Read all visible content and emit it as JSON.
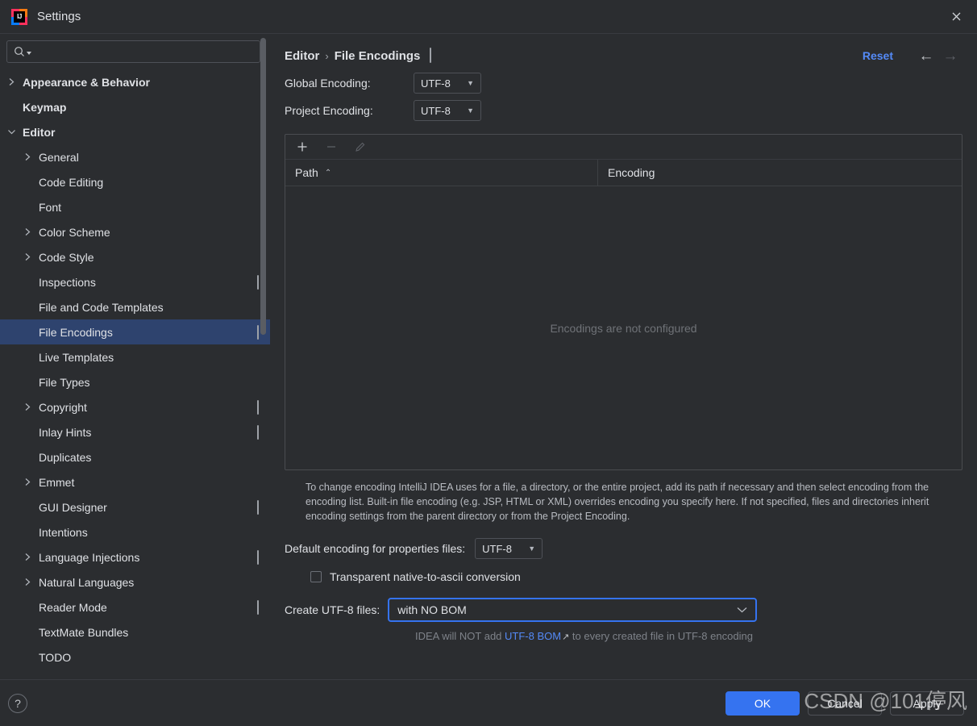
{
  "window": {
    "title": "Settings",
    "logo_icon": "intellij-idea-logo",
    "close_icon": "close-icon"
  },
  "search": {
    "value": "",
    "placeholder": "",
    "icon": "search-icon"
  },
  "sidebar": {
    "items": [
      {
        "label": "Appearance & Behavior",
        "level": 0,
        "arrow": "chevron-right",
        "bold": true,
        "badge": false,
        "selected": false
      },
      {
        "label": "Keymap",
        "level": 0,
        "arrow": "none",
        "bold": true,
        "badge": false,
        "selected": false
      },
      {
        "label": "Editor",
        "level": 0,
        "arrow": "chevron-down",
        "bold": true,
        "badge": false,
        "selected": false
      },
      {
        "label": "General",
        "level": 1,
        "arrow": "chevron-right",
        "bold": false,
        "badge": false,
        "selected": false
      },
      {
        "label": "Code Editing",
        "level": 1,
        "arrow": "none",
        "bold": false,
        "badge": false,
        "selected": false
      },
      {
        "label": "Font",
        "level": 1,
        "arrow": "none",
        "bold": false,
        "badge": false,
        "selected": false
      },
      {
        "label": "Color Scheme",
        "level": 1,
        "arrow": "chevron-right",
        "bold": false,
        "badge": false,
        "selected": false
      },
      {
        "label": "Code Style",
        "level": 1,
        "arrow": "chevron-right",
        "bold": false,
        "badge": false,
        "selected": false
      },
      {
        "label": "Inspections",
        "level": 1,
        "arrow": "none",
        "bold": false,
        "badge": true,
        "selected": false
      },
      {
        "label": "File and Code Templates",
        "level": 1,
        "arrow": "none",
        "bold": false,
        "badge": false,
        "selected": false
      },
      {
        "label": "File Encodings",
        "level": 1,
        "arrow": "none",
        "bold": false,
        "badge": true,
        "selected": true
      },
      {
        "label": "Live Templates",
        "level": 1,
        "arrow": "none",
        "bold": false,
        "badge": false,
        "selected": false
      },
      {
        "label": "File Types",
        "level": 1,
        "arrow": "none",
        "bold": false,
        "badge": false,
        "selected": false
      },
      {
        "label": "Copyright",
        "level": 1,
        "arrow": "chevron-right",
        "bold": false,
        "badge": true,
        "selected": false
      },
      {
        "label": "Inlay Hints",
        "level": 1,
        "arrow": "none",
        "bold": false,
        "badge": true,
        "selected": false
      },
      {
        "label": "Duplicates",
        "level": 1,
        "arrow": "none",
        "bold": false,
        "badge": false,
        "selected": false
      },
      {
        "label": "Emmet",
        "level": 1,
        "arrow": "chevron-right",
        "bold": false,
        "badge": false,
        "selected": false
      },
      {
        "label": "GUI Designer",
        "level": 1,
        "arrow": "none",
        "bold": false,
        "badge": true,
        "selected": false
      },
      {
        "label": "Intentions",
        "level": 1,
        "arrow": "none",
        "bold": false,
        "badge": false,
        "selected": false
      },
      {
        "label": "Language Injections",
        "level": 1,
        "arrow": "chevron-right",
        "bold": false,
        "badge": true,
        "selected": false
      },
      {
        "label": "Natural Languages",
        "level": 1,
        "arrow": "chevron-right",
        "bold": false,
        "badge": false,
        "selected": false
      },
      {
        "label": "Reader Mode",
        "level": 1,
        "arrow": "none",
        "bold": false,
        "badge": true,
        "selected": false
      },
      {
        "label": "TextMate Bundles",
        "level": 1,
        "arrow": "none",
        "bold": false,
        "badge": false,
        "selected": false
      },
      {
        "label": "TODO",
        "level": 1,
        "arrow": "none",
        "bold": false,
        "badge": false,
        "selected": false
      }
    ]
  },
  "header": {
    "breadcrumb_parent": "Editor",
    "breadcrumb_separator": "›",
    "breadcrumb_current": "File Encodings",
    "badge_icon": "project-level-badge-icon",
    "reset_label": "Reset",
    "back_icon": "←",
    "forward_icon": "→"
  },
  "encodings": {
    "global_label": "Global Encoding:",
    "global_value": "UTF-8",
    "project_label": "Project Encoding:",
    "project_value": "UTF-8",
    "toolbar": {
      "add_icon": "plus-icon",
      "remove_icon": "minus-icon",
      "edit_icon": "pencil-icon"
    },
    "columns": [
      "Path",
      "Encoding"
    ],
    "sort_indicator": "⌃",
    "rows": [],
    "empty_text": "Encodings are not configured",
    "description": "To change encoding IntelliJ IDEA uses for a file, a directory, or the entire project, add its path if necessary and then select encoding from the encoding list. Built-in file encoding (e.g. JSP, HTML or XML) overrides encoding you specify here. If not specified, files and directories inherit encoding settings from the parent directory or from the Project Encoding."
  },
  "properties": {
    "default_encoding_label": "Default encoding for properties files:",
    "default_encoding_value": "UTF-8",
    "transparent_label": "Transparent native-to-ascii conversion",
    "transparent_checked": false
  },
  "utf8": {
    "label": "Create UTF-8 files:",
    "value": "with NO BOM",
    "caret_icon": "chevron-down-icon",
    "hint_prefix": "IDEA will NOT add ",
    "hint_link": "UTF-8 BOM",
    "hint_link_icon": "↗",
    "hint_suffix": " to every created file in UTF-8 encoding"
  },
  "footer": {
    "help_label": "?",
    "ok_label": "OK",
    "cancel_label": "Cancel",
    "apply_label": "Apply"
  },
  "watermark": {
    "text": "CSDN @101停风"
  },
  "colors": {
    "accent": "#3573f0",
    "link": "#548af7",
    "selection": "#2e436e",
    "background": "#2b2d30",
    "border": "#4e5157",
    "muted_text": "#7e8289"
  }
}
